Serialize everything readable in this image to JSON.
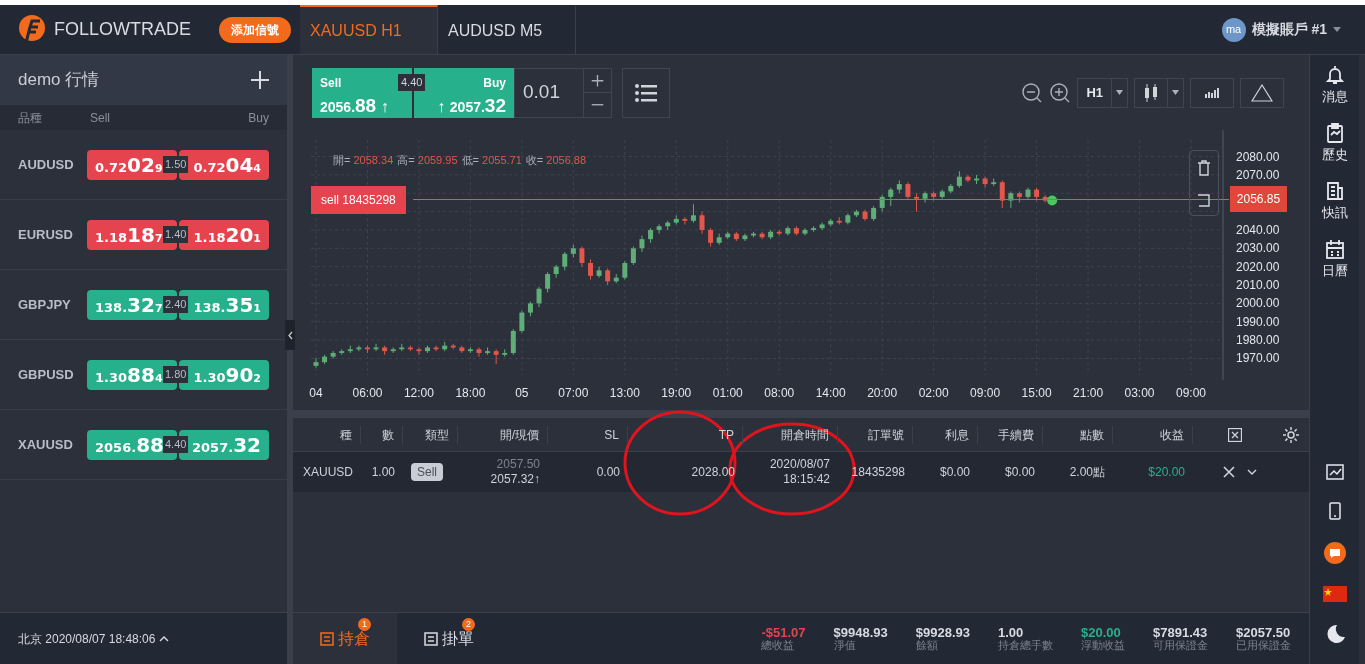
{
  "header": {
    "brand": "FOLLOWTRADE",
    "signal_button": "添加信號",
    "tabs": [
      {
        "label": "XAUUSD H1",
        "selected": true
      },
      {
        "label": "AUDUSD M5",
        "selected": false
      }
    ],
    "avatar": "ma",
    "account": "模擬賬戶 #1"
  },
  "watchlist": {
    "title": "demo 行情",
    "columns": [
      "品種",
      "Sell",
      "Buy"
    ],
    "rows": [
      {
        "symbol": "AUDUSD",
        "color": "#e5444f",
        "spread": "1.50",
        "sell": {
          "prefix": "0.72",
          "big": "02",
          "small": "9"
        },
        "buy": {
          "prefix": "0.72",
          "big": "04",
          "small": "4"
        }
      },
      {
        "symbol": "EURUSD",
        "color": "#e5444f",
        "spread": "1.40",
        "sell": {
          "prefix": "1.18",
          "big": "18",
          "small": "7"
        },
        "buy": {
          "prefix": "1.18",
          "big": "20",
          "small": "1"
        }
      },
      {
        "symbol": "GBPJPY",
        "color": "#26b08b",
        "spread": "2.40",
        "sell": {
          "prefix": "138.",
          "big": "32",
          "small": "7"
        },
        "buy": {
          "prefix": "138.",
          "big": "35",
          "small": "1"
        }
      },
      {
        "symbol": "GBPUSD",
        "color": "#26b08b",
        "spread": "1.80",
        "sell": {
          "prefix": "1.30",
          "big": "88",
          "small": "4"
        },
        "buy": {
          "prefix": "1.30",
          "big": "90",
          "small": "2"
        }
      },
      {
        "symbol": "XAUUSD",
        "color": "#26b08b",
        "spread": "4.40",
        "sell": {
          "prefix": "2056.",
          "big": "88"
        },
        "buy": {
          "prefix": "2057.",
          "big": "32"
        }
      }
    ]
  },
  "clock": "北京 2020/08/07 18:48:06",
  "ticket": {
    "sell_label": "Sell",
    "sell_prefix": "2056.",
    "sell_big": "88",
    "spread": "4.40",
    "buy_label": "Buy",
    "buy_prefix": "2057.",
    "buy_big": "32",
    "arrow": "↑",
    "lots": "0.01"
  },
  "chart_toolbar": {
    "timeframe": "H1"
  },
  "chart": {
    "ohlc": [
      {
        "label": "開=",
        "value": "2058.34"
      },
      {
        "label": "高=",
        "value": "2059.95"
      },
      {
        "label": "低=",
        "value": "2055.71"
      },
      {
        "label": "收=",
        "value": "2056.88"
      }
    ],
    "order_line": "sell 18435298",
    "current_price": "2056.85",
    "chart_data": {
      "type": "candlestick",
      "ylim": [
        1961,
        2089
      ],
      "grid": true,
      "categories": [
        "04",
        null,
        null,
        null,
        null,
        null,
        "06:00",
        null,
        null,
        null,
        null,
        null,
        "12:00",
        null,
        null,
        null,
        null,
        null,
        "18:00",
        null,
        null,
        null,
        null,
        null,
        "05",
        null,
        null,
        null,
        null,
        null,
        "07:00",
        null,
        null,
        null,
        null,
        null,
        "13:00",
        null,
        null,
        null,
        null,
        null,
        "19:00",
        null,
        null,
        null,
        null,
        null,
        "01:00",
        null,
        null,
        null,
        null,
        null,
        "08:00",
        null,
        null,
        null,
        null,
        null,
        "14:00",
        null,
        null,
        null,
        null,
        null,
        "20:00",
        null,
        null,
        null,
        null,
        null,
        "02:00",
        null,
        null,
        null,
        null,
        null,
        "09:00",
        null,
        null,
        null,
        null,
        null,
        "15:00",
        null,
        null,
        null,
        null,
        null,
        "21:00",
        null,
        null,
        null,
        null,
        null,
        "03:00",
        null,
        null,
        null,
        null,
        null,
        "09:00"
      ],
      "ohlc": [
        [
          1966,
          1970,
          1965,
          1968
        ],
        [
          1968,
          1972,
          1967,
          1971
        ],
        [
          1971,
          1974,
          1970,
          1973
        ],
        [
          1973,
          1975,
          1972,
          1974
        ],
        [
          1974,
          1977,
          1973,
          1975
        ],
        [
          1975,
          1977,
          1974,
          1976
        ],
        [
          1976,
          1977,
          1973,
          1975
        ],
        [
          1975,
          1978,
          1974,
          1976
        ],
        [
          1976,
          1977,
          1972,
          1974
        ],
        [
          1974,
          1976,
          1973,
          1975
        ],
        [
          1975,
          1978,
          1974,
          1976
        ],
        [
          1976,
          1977,
          1974,
          1975
        ],
        [
          1975,
          1976,
          1972,
          1974
        ],
        [
          1974,
          1977,
          1973,
          1976
        ],
        [
          1976,
          1977,
          1974,
          1975
        ],
        [
          1975,
          1979,
          1974,
          1977
        ],
        [
          1977,
          1978,
          1975,
          1976
        ],
        [
          1976,
          1977,
          1973,
          1974
        ],
        [
          1974,
          1976,
          1973,
          1975
        ],
        [
          1975,
          1976,
          1971,
          1973
        ],
        [
          1973,
          1976,
          1972,
          1974
        ],
        [
          1974,
          1975,
          1967,
          1972
        ],
        [
          1972,
          1975,
          1971,
          1973
        ],
        [
          1973,
          1986,
          1972,
          1985
        ],
        [
          1985,
          1996,
          1984,
          1995
        ],
        [
          1995,
          2001,
          1993,
          2000
        ],
        [
          2000,
          2009,
          1998,
          2008
        ],
        [
          2008,
          2017,
          2006,
          2016
        ],
        [
          2016,
          2021,
          2014,
          2020
        ],
        [
          2020,
          2028,
          2018,
          2027
        ],
        [
          2027,
          2032,
          2025,
          2030
        ],
        [
          2030,
          2031,
          2020,
          2022
        ],
        [
          2022,
          2024,
          2013,
          2015
        ],
        [
          2015,
          2020,
          2014,
          2018
        ],
        [
          2018,
          2019,
          2010,
          2012
        ],
        [
          2012,
          2016,
          2011,
          2014
        ],
        [
          2014,
          2023,
          2013,
          2022
        ],
        [
          2022,
          2031,
          2021,
          2030
        ],
        [
          2030,
          2037,
          2028,
          2035
        ],
        [
          2035,
          2041,
          2033,
          2040
        ],
        [
          2040,
          2043,
          2038,
          2042
        ],
        [
          2042,
          2045,
          2040,
          2044
        ],
        [
          2044,
          2048,
          2043,
          2046
        ],
        [
          2046,
          2047,
          2043,
          2045
        ],
        [
          2045,
          2054,
          2044,
          2048
        ],
        [
          2048,
          2050,
          2038,
          2040
        ],
        [
          2040,
          2041,
          2031,
          2033
        ],
        [
          2033,
          2038,
          2032,
          2036
        ],
        [
          2036,
          2039,
          2035,
          2038
        ],
        [
          2038,
          2039,
          2034,
          2035
        ],
        [
          2035,
          2038,
          2034,
          2037
        ],
        [
          2037,
          2039,
          2036,
          2038
        ],
        [
          2038,
          2039,
          2035,
          2036
        ],
        [
          2036,
          2040,
          2035,
          2039
        ],
        [
          2039,
          2040,
          2037,
          2038
        ],
        [
          2038,
          2042,
          2037,
          2041
        ],
        [
          2041,
          2042,
          2037,
          2038
        ],
        [
          2038,
          2041,
          2037,
          2040
        ],
        [
          2040,
          2042,
          2039,
          2041
        ],
        [
          2041,
          2044,
          2040,
          2043
        ],
        [
          2043,
          2046,
          2042,
          2045
        ],
        [
          2045,
          2047,
          2043,
          2044
        ],
        [
          2044,
          2049,
          2043,
          2048
        ],
        [
          2048,
          2051,
          2047,
          2050
        ],
        [
          2050,
          2051,
          2045,
          2046
        ],
        [
          2046,
          2053,
          2045,
          2052
        ],
        [
          2052,
          2059,
          2050,
          2058
        ],
        [
          2058,
          2063,
          2053,
          2062
        ],
        [
          2062,
          2067,
          2060,
          2065
        ],
        [
          2065,
          2066,
          2057,
          2058
        ],
        [
          2058,
          2060,
          2050,
          2057
        ],
        [
          2057,
          2061,
          2055,
          2060
        ],
        [
          2060,
          2061,
          2056,
          2058
        ],
        [
          2058,
          2062,
          2057,
          2061
        ],
        [
          2061,
          2065,
          2060,
          2064
        ],
        [
          2064,
          2072,
          2063,
          2069
        ],
        [
          2069,
          2070,
          2066,
          2067
        ],
        [
          2067,
          2070,
          2065,
          2068
        ],
        [
          2068,
          2069,
          2063,
          2065
        ],
        [
          2065,
          2068,
          2064,
          2066
        ],
        [
          2066,
          2067,
          2052,
          2056
        ],
        [
          2056,
          2061,
          2052,
          2060
        ],
        [
          2060,
          2061,
          2055,
          2058
        ],
        [
          2058,
          2063,
          2057,
          2062
        ],
        [
          2062,
          2063,
          2056,
          2058
        ],
        [
          2058,
          2059,
          2055,
          2056
        ],
        null,
        null,
        null,
        null,
        null,
        null,
        null,
        null,
        null,
        null,
        null,
        null,
        null,
        null,
        null,
        null,
        null
      ],
      "yticks": [
        {
          "value": 2080,
          "label": "2080.00"
        },
        {
          "value": 2070,
          "label": "2070.00"
        },
        {
          "value": 2040,
          "label": "2040.00"
        },
        {
          "value": 2030,
          "label": "2030.00"
        },
        {
          "value": 2020,
          "label": "2020.00"
        },
        {
          "value": 2010,
          "label": "2010.00"
        },
        {
          "value": 2000,
          "label": "2000.00"
        },
        {
          "value": 1990,
          "label": "1990.00"
        },
        {
          "value": 1980,
          "label": "1980.00"
        },
        {
          "value": 1970,
          "label": "1970.00"
        }
      ]
    }
  },
  "positions": {
    "columns": [
      "種",
      "數",
      "類型",
      "開/現價",
      "SL",
      "TP",
      "開倉時間",
      "訂單號",
      "利息",
      "手續費",
      "點數",
      "收益"
    ],
    "rows": [
      {
        "symbol": "XAUUSD",
        "lots": "1.00",
        "type": "Sell",
        "open": "2057.50",
        "current": "2057.32↑",
        "sl": "0.00",
        "tp": "2028.00",
        "date": "2020/08/07",
        "time": "18:15:42",
        "order": "18435298",
        "interest": "$0.00",
        "fee": "$0.00",
        "points": "2.00點",
        "profit": "$20.00"
      }
    ]
  },
  "bottom_tabs": [
    {
      "label": "持倉",
      "badge": "1",
      "selected": true
    },
    {
      "label": "掛單",
      "badge": "2",
      "selected": false
    }
  ],
  "summary": [
    {
      "value": "-$51.07",
      "label": "總收益",
      "color": "#e5444f"
    },
    {
      "value": "$9948.93",
      "label": "淨值",
      "color": "#d8dbe1"
    },
    {
      "value": "$9928.93",
      "label": "餘額",
      "color": "#d8dbe1"
    },
    {
      "value": "1.00",
      "label": "持倉總手數",
      "color": "#d8dbe1"
    },
    {
      "value": "$20.00",
      "label": "浮動收益",
      "color": "#26b08b"
    },
    {
      "value": "$7891.43",
      "label": "可用保證金",
      "color": "#d8dbe1"
    },
    {
      "value": "$2057.50",
      "label": "已用保證金",
      "color": "#d8dbe1"
    }
  ],
  "side_menu": [
    {
      "label": "消息",
      "kind": "bell"
    },
    {
      "label": "歷史",
      "kind": "history"
    },
    {
      "label": "快訊",
      "kind": "news"
    },
    {
      "label": "日曆",
      "kind": "calendar"
    }
  ]
}
